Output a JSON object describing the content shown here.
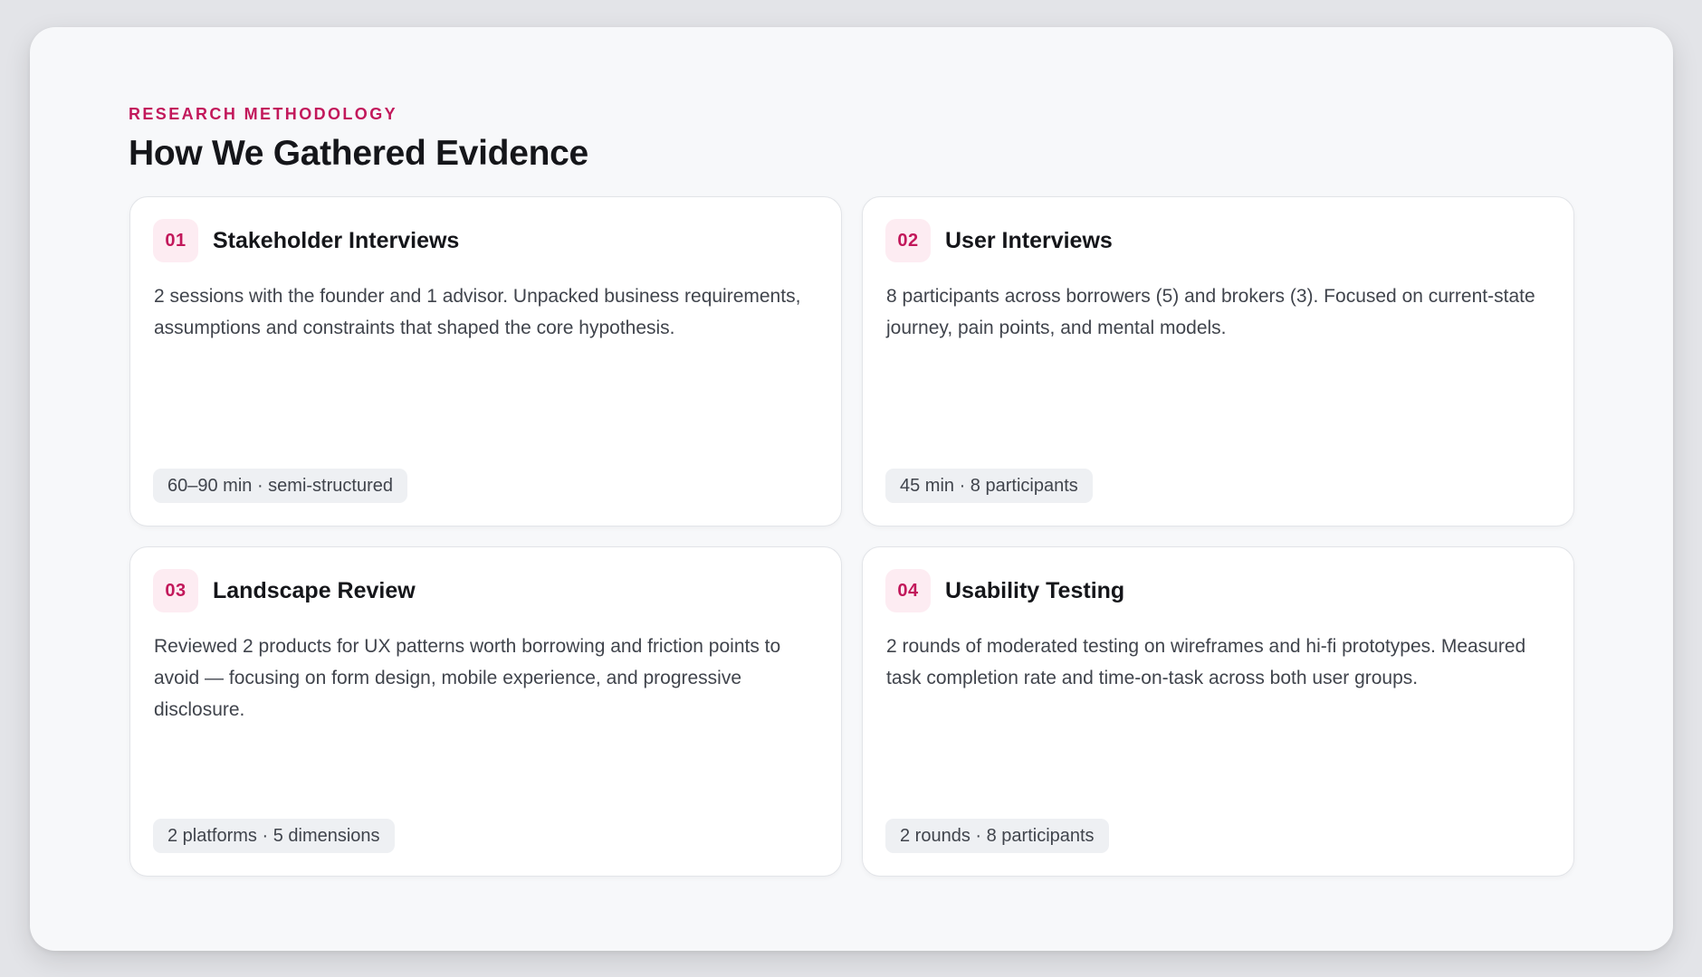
{
  "section": {
    "eyebrow": "RESEARCH METHODOLOGY",
    "title": "How We Gathered Evidence"
  },
  "accent_color": "#c2185b",
  "cards": [
    {
      "number": "01",
      "title": "Stakeholder Interviews",
      "description": "2 sessions with the founder and 1 advisor. Unpacked business requirements, assumptions and constraints that shaped the core hypothesis.",
      "tag": "60–90 min · semi-structured"
    },
    {
      "number": "02",
      "title": "User Interviews",
      "description": "8 participants across borrowers (5) and brokers (3). Focused on current-state journey, pain points, and mental models.",
      "tag": "45 min · 8 participants"
    },
    {
      "number": "03",
      "title": "Landscape Review",
      "description": "Reviewed 2 products for UX patterns worth borrowing and friction points to avoid — focusing on form design, mobile experience, and progressive disclosure.",
      "tag": "2 platforms · 5 dimensions"
    },
    {
      "number": "04",
      "title": "Usability Testing",
      "description": "2 rounds of moderated testing on wireframes and hi-fi prototypes. Measured task completion rate and time-on-task across both user groups.",
      "tag": "2 rounds · 8 participants"
    }
  ]
}
